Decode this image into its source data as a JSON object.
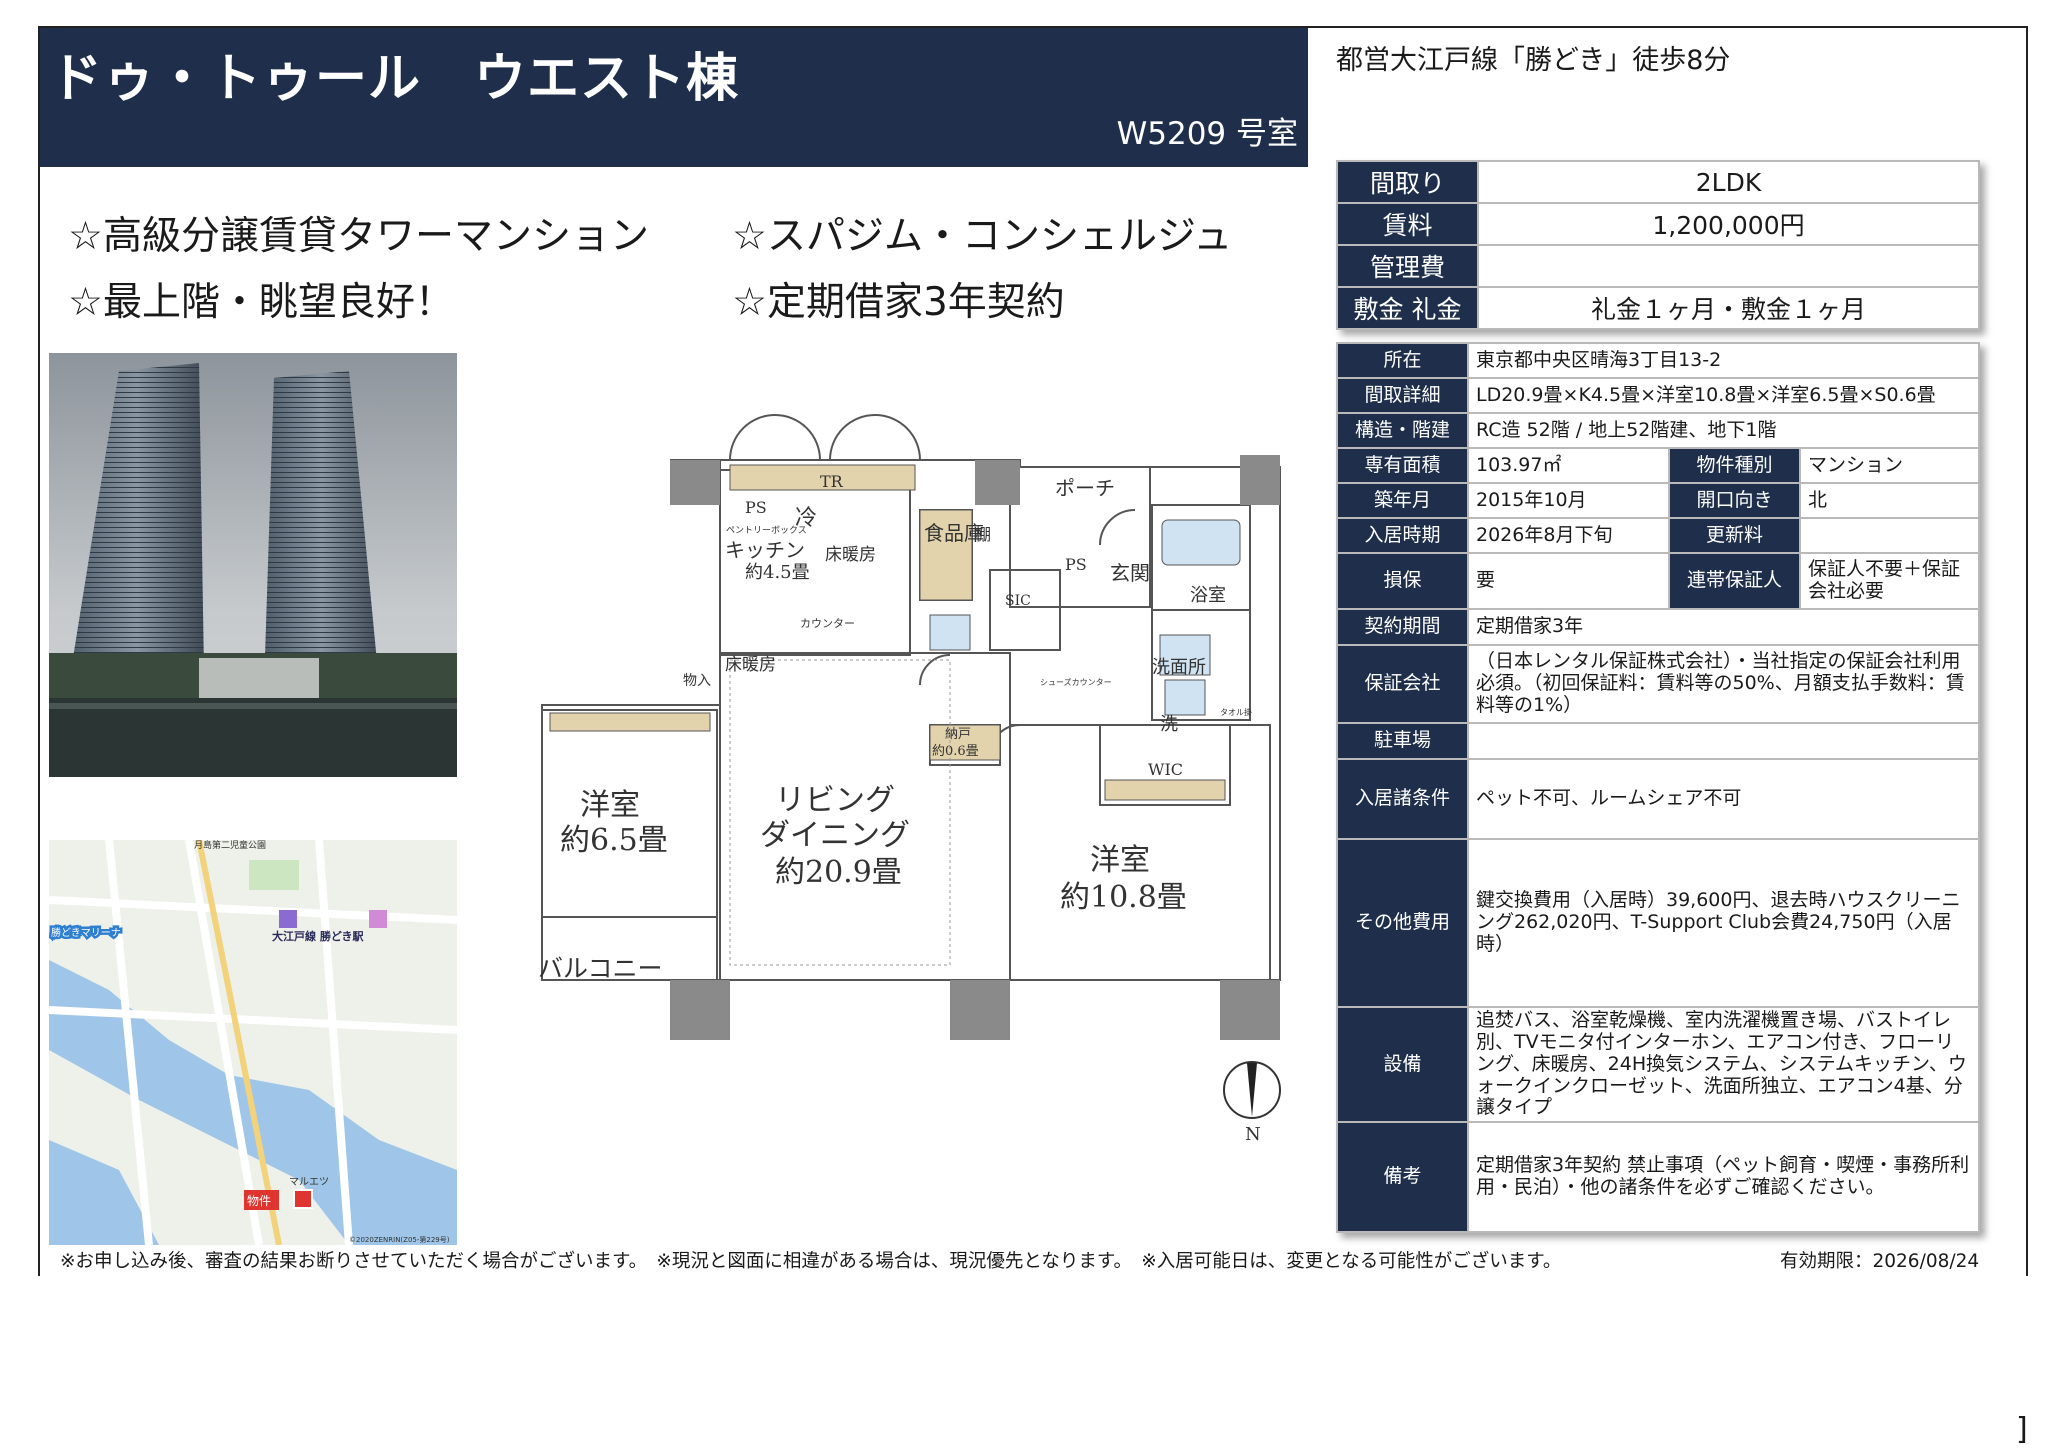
{
  "header": {
    "title": "ドゥ・トゥール　ウエスト棟",
    "room": "W5209 号室"
  },
  "access": "都営大江戸線「勝どき」徒歩8分",
  "features": [
    "☆高級分譲賃貸タワーマンション",
    "☆スパジム・コンシェルジュ",
    "☆最上階・眺望良好！",
    "☆定期借家3年契約"
  ],
  "summary": [
    {
      "label": "間取り",
      "value": "2LDK"
    },
    {
      "label": "賃料",
      "value": "1,200,000円"
    },
    {
      "label": "管理費",
      "value": ""
    },
    {
      "label": "敷金 礼金",
      "value": "礼金１ヶ月・敷金１ヶ月"
    }
  ],
  "details": {
    "address_label": "所在",
    "address": "東京都中央区晴海3丁目13-2",
    "layout_label": "間取詳細",
    "layout": "LD20.9畳×K4.5畳×洋室10.8畳×洋室6.5畳×S0.6畳",
    "structure_label": "構造・階建",
    "structure": "RC造 52階 / 地上52階建、地下1階",
    "area_label": "専有面積",
    "area": "103.97㎡",
    "type_label": "物件種別",
    "type": "マンション",
    "built_label": "築年月",
    "built": "2015年10月",
    "direction_label": "開口向き",
    "direction": "北",
    "movein_label": "入居時期",
    "movein": "2026年8月下旬",
    "renewal_label": "更新料",
    "renewal": "",
    "insurance_label": "損保",
    "insurance": "要",
    "guarantor_label": "連帯保証人",
    "guarantor": "保証人不要＋保証会社必要",
    "contract_label": "契約期間",
    "contract": "定期借家3年",
    "guarantee_label": "保証会社",
    "guarantee": "（日本レンタル保証株式会社）・当社指定の保証会社利用必須。（初回保証料：賃料等の50%、月額支払手数料：賃料等の1%）",
    "parking_label": "駐車場",
    "parking": "",
    "conditions_label": "入居諸条件",
    "conditions": "ペット不可、ルームシェア不可",
    "other_label": "その他費用",
    "other": "鍵交換費用（入居時）39,600円、退去時ハウスクリーニング262,020円、T-Support Club会費24,750円（入居時）",
    "equipment_label": "設備",
    "equipment": "追焚バス、浴室乾燥機、室内洗濯機置き場、バストイレ別、TVモニタ付インターホン、エアコン付き、フローリング、床暖房、24H換気システム、システムキッチン、ウォークインクローゼット、洗面所独立、エアコン4基、分譲タイプ",
    "remarks_label": "備考",
    "remarks": "定期借家3年契約 禁止事項（ペット飼育・喫煙・事務所利用・民泊）・他の諸条件を必ずご確認ください。"
  },
  "floorplan": {
    "tr": "TR",
    "ps1": "PS",
    "ps2": "PS",
    "fridge": "冷",
    "pantry_box": "ペントリーボックス",
    "kitchen": "キッチン",
    "kitchen_size": "約4.5畳",
    "floor_heat1": "床暖房",
    "floor_heat2": "床暖房",
    "counter": "カウンター",
    "food_storage": "食品庫",
    "shelf": "棚",
    "sic": "SIC",
    "entrance": "玄関",
    "porch": "ポーチ",
    "bath": "浴室",
    "washroom": "洗面所",
    "laundry": "洗",
    "towel": "タオル掛",
    "shoe_counter": "シューズカウンター",
    "closet_in": "物入",
    "storage": "納戸",
    "storage_size": "約0.6畳",
    "wic": "WIC",
    "room1": "洋室",
    "room1_size": "約6.5畳",
    "living1": "リビング",
    "living2": "ダイニング",
    "living_size": "約20.9畳",
    "room2": "洋室",
    "room2_size": "約10.8畳",
    "balcony": "バルコニー",
    "north": "N"
  },
  "map": {
    "label_park": "月島第二児童公園",
    "label_marina": "勝どきマリーナ",
    "label_station": "大江戸線 勝どき駅",
    "label_property": "物件",
    "label_maruetsu": "マルエツ",
    "copyright": "©2020ZENRIN(Z05-第229号)"
  },
  "footer": {
    "note": "※お申し込み後、審査の結果お断りさせていただく場合がございます。　※現況と図面に相違がある場合は、現況優先となります。　※入居可能日は、変更となる可能性がございます。",
    "validity": "有効期限：2026/08/24",
    "bracket": "]"
  }
}
